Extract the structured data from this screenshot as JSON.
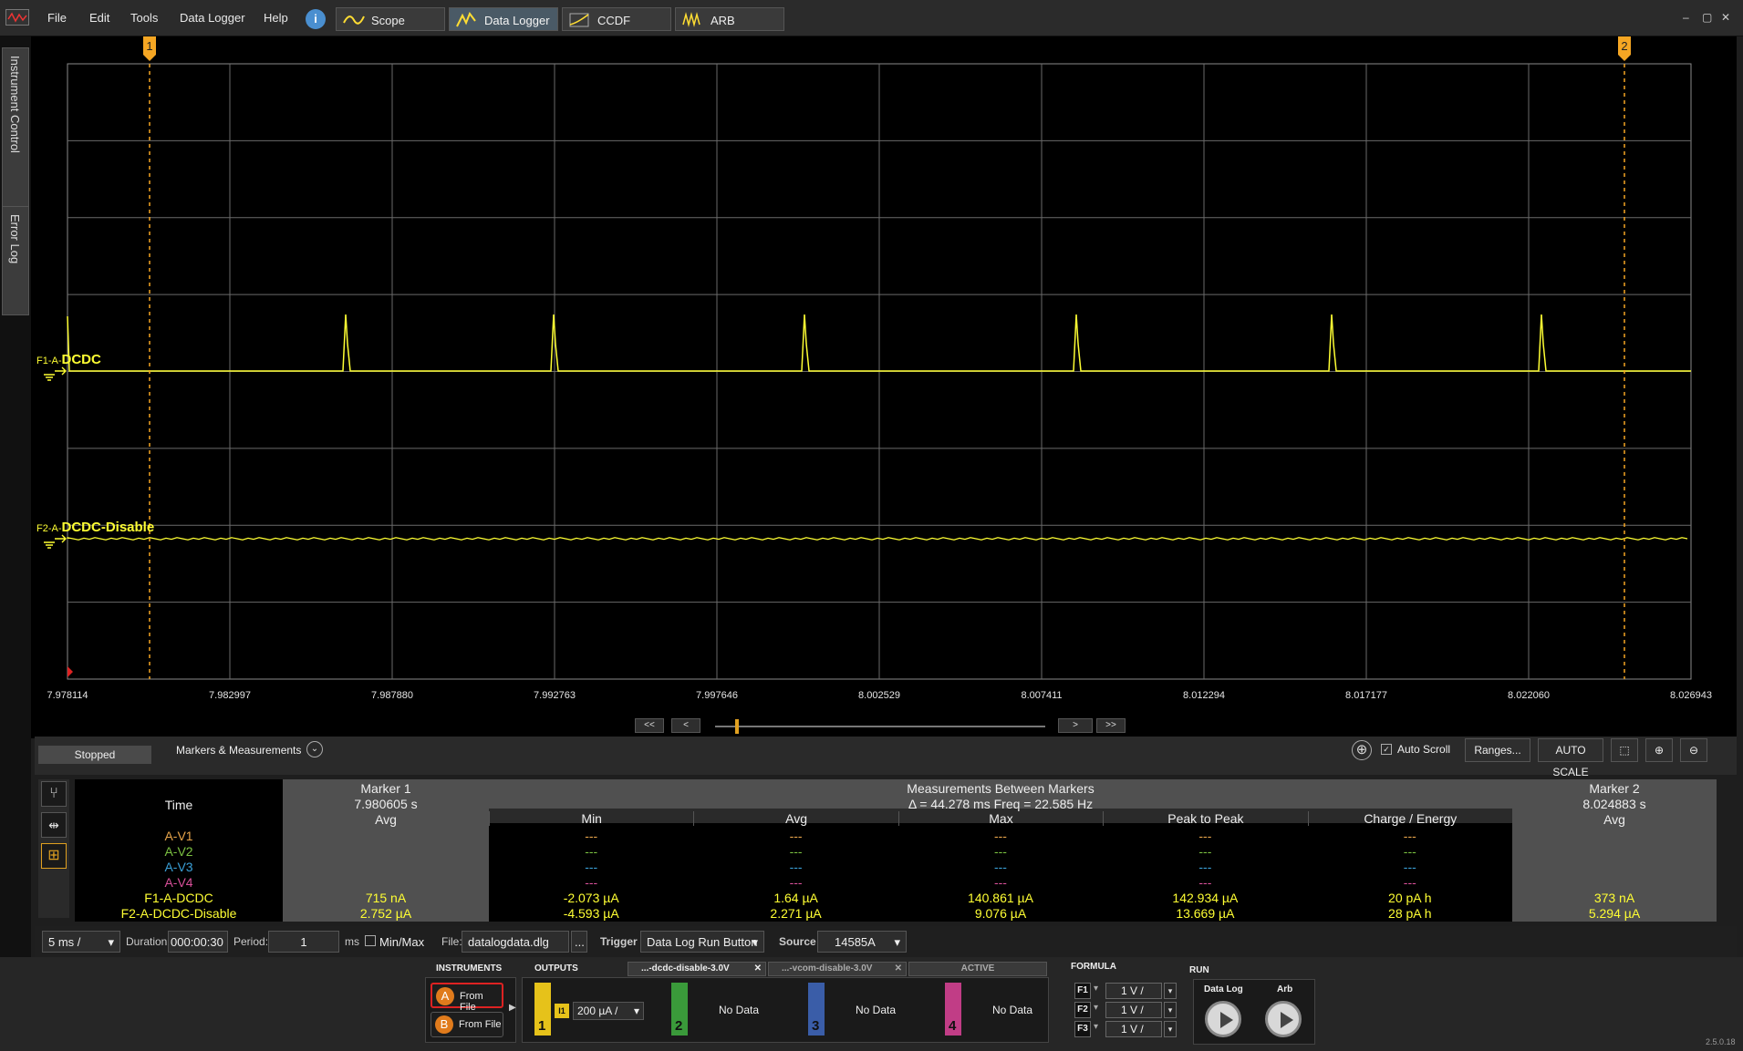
{
  "menu": {
    "items": [
      "File",
      "Edit",
      "Tools",
      "Data Logger",
      "Help"
    ],
    "tabs": [
      {
        "label": "Scope",
        "active": false
      },
      {
        "label": "Data Logger",
        "active": true
      },
      {
        "label": "CCDF",
        "active": false
      },
      {
        "label": "ARB",
        "active": false
      }
    ],
    "window_buttons": [
      "‒",
      "▢",
      "✕"
    ]
  },
  "sidebar": {
    "tabs": [
      "Instrument Control",
      "Error Log"
    ]
  },
  "plot": {
    "markers": [
      "1",
      "2"
    ],
    "traces": [
      {
        "prefix": "F1-A-",
        "name": "DCDC"
      },
      {
        "prefix": "F2-A-",
        "name": "DCDC-Disable"
      }
    ],
    "x_ticks": [
      "7.978114",
      "7.982997",
      "7.987880",
      "7.992763",
      "7.997646",
      "8.002529",
      "8.007411",
      "8.012294",
      "8.017177",
      "8.022060",
      "8.026943"
    ],
    "trace_color": "#ffff33",
    "marker_color": "#f5a623"
  },
  "nav": {
    "buttons": [
      "<<",
      "<",
      ">",
      ">>"
    ]
  },
  "panel": {
    "status": "Stopped",
    "markers_title": "Markers & Measurements",
    "auto_scroll": "Auto Scroll",
    "auto_scroll_checked": true,
    "ranges": "Ranges...",
    "auto_scale": "AUTO SCALE"
  },
  "measurements": {
    "time_label": "Time",
    "marker1": {
      "title": "Marker 1",
      "time": "7.980605 s",
      "sub": "Avg"
    },
    "between": {
      "title": "Measurements Between Markers",
      "delta": "Δ = 44.278 ms   Freq = 22.585 Hz"
    },
    "marker2": {
      "title": "Marker 2",
      "time": "8.024883 s",
      "sub": "Avg"
    },
    "columns": [
      "Min",
      "Avg",
      "Max",
      "Peak to Peak",
      "Charge / Energy"
    ],
    "rows": [
      {
        "name": "A-V1",
        "color": "#e8a54b",
        "m1": "",
        "vals": [
          "---",
          "---",
          "---",
          "---",
          "---"
        ],
        "m2": ""
      },
      {
        "name": "A-V2",
        "color": "#7cc242",
        "m1": "",
        "vals": [
          "---",
          "---",
          "---",
          "---",
          "---"
        ],
        "m2": ""
      },
      {
        "name": "A-V3",
        "color": "#3aa0d8",
        "m1": "",
        "vals": [
          "---",
          "---",
          "---",
          "---",
          "---"
        ],
        "m2": ""
      },
      {
        "name": "A-V4",
        "color": "#d9509a",
        "m1": "",
        "vals": [
          "---",
          "---",
          "---",
          "---",
          "---"
        ],
        "m2": ""
      },
      {
        "name": "F1-A-DCDC",
        "color": "#ffff33",
        "m1": "715 nA",
        "vals": [
          "-2.073 µA",
          "1.64 µA",
          "140.861 µA",
          "142.934 µA",
          "20 pA h"
        ],
        "m2": "373 nA"
      },
      {
        "name": "F2-A-DCDC-Disable",
        "color": "#ffff33",
        "m1": "2.752 µA",
        "vals": [
          "-4.593 µA",
          "2.271 µA",
          "9.076 µA",
          "13.669 µA",
          "28 pA h"
        ],
        "m2": "5.294 µA"
      }
    ]
  },
  "controls": {
    "timebase": "5 ms /",
    "duration_label": "Duration:",
    "duration": "000:00:30",
    "period_label": "Period:",
    "period": "1",
    "period_unit": "ms",
    "minmax_label": "Min/Max",
    "file_label": "File:",
    "file": "datalogdata.dlg",
    "browse": "...",
    "trigger_label": "Trigger",
    "trigger": "Data Log Run Button",
    "source_label": "Source",
    "source": "14585A"
  },
  "footer": {
    "instruments_title": "INSTRUMENTS",
    "outputs_title": "OUTPUTS",
    "file_tabs": [
      "...-dcdc-disable-3.0V",
      "...-vcom-disable-3.0V"
    ],
    "active_label": "ACTIVE",
    "formula_title": "FORMULA",
    "run_title": "RUN",
    "instruments": [
      {
        "badge": "A",
        "label": "From File"
      },
      {
        "badge": "B",
        "label": "From File"
      }
    ],
    "outputs": [
      {
        "num": "1",
        "color": "#e6c21a",
        "value": "200 µA /",
        "tag": "I1"
      },
      {
        "num": "2",
        "color": "#3a9a3a",
        "value": "No Data"
      },
      {
        "num": "3",
        "color": "#3a5da8",
        "value": "No Data"
      },
      {
        "num": "4",
        "color": "#c13d86",
        "value": "No Data"
      }
    ],
    "formulas": [
      {
        "tag": "F1",
        "value": "1 V /"
      },
      {
        "tag": "F2",
        "value": "1 V /"
      },
      {
        "tag": "F3",
        "value": "1 V /"
      }
    ],
    "run": {
      "datalog": "Data Log",
      "arb": "Arb"
    },
    "version": "2.5.0.18"
  }
}
